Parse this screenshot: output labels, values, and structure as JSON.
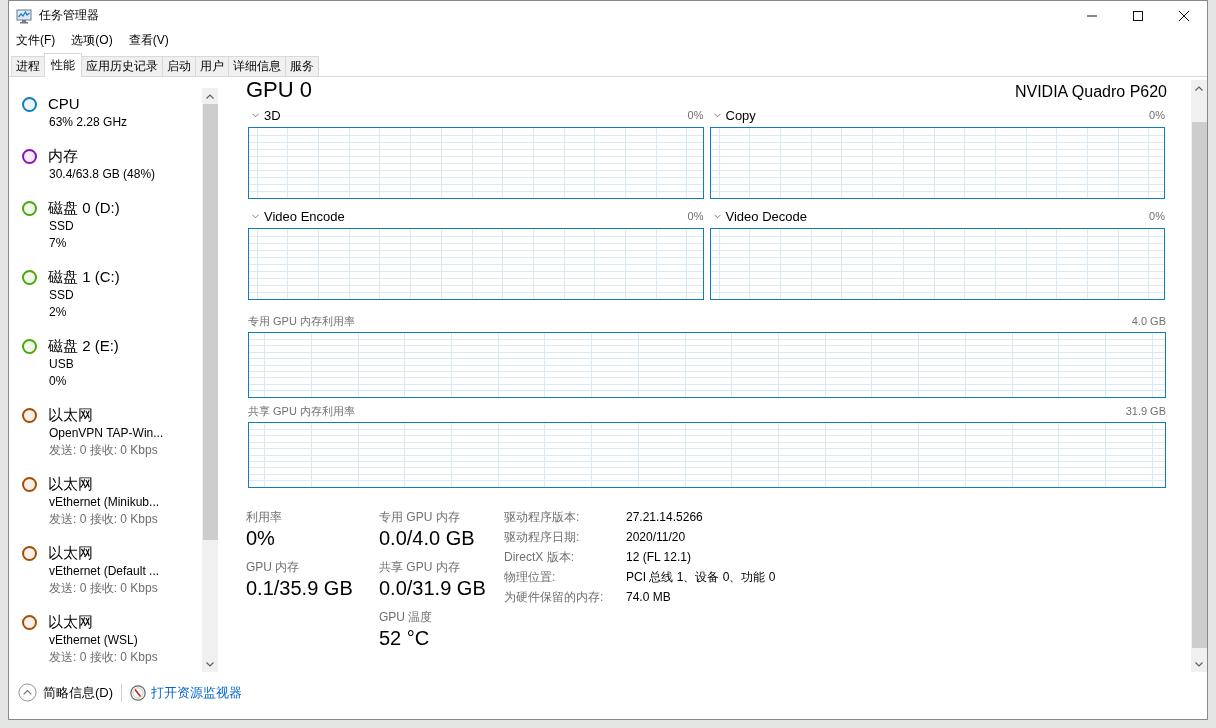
{
  "window": {
    "title": "任务管理器"
  },
  "menu": [
    {
      "label": "文件(F)"
    },
    {
      "label": "选项(O)"
    },
    {
      "label": "查看(V)"
    }
  ],
  "tabs": [
    {
      "label": "进程",
      "selected": false
    },
    {
      "label": "性能",
      "selected": true
    },
    {
      "label": "应用历史记录",
      "selected": false
    },
    {
      "label": "启动",
      "selected": false
    },
    {
      "label": "用户",
      "selected": false
    },
    {
      "label": "详细信息",
      "selected": false
    },
    {
      "label": "服务",
      "selected": false
    }
  ],
  "sidebar": {
    "items": [
      {
        "name": "CPU",
        "color": "#117dbb",
        "details": [
          "63% 2.28 GHz"
        ]
      },
      {
        "name": "内存",
        "color": "#8b12ae",
        "details": [
          "30.4/63.8 GB (48%)"
        ]
      },
      {
        "name": "磁盘 0 (D:)",
        "color": "#4da60c",
        "details": [
          "SSD",
          "7%"
        ]
      },
      {
        "name": "磁盘 1 (C:)",
        "color": "#4da60c",
        "details": [
          "SSD",
          "2%"
        ]
      },
      {
        "name": "磁盘 2 (E:)",
        "color": "#4da60c",
        "details": [
          "USB",
          "0%"
        ]
      },
      {
        "name": "以太网",
        "color": "#a74f01",
        "details": [
          "OpenVPN TAP-Win..."
        ],
        "throughput": "发送: 0 接收: 0 Kbps"
      },
      {
        "name": "以太网",
        "color": "#a74f01",
        "details": [
          "vEthernet (Minikub..."
        ],
        "throughput": "发送: 0 接收: 0 Kbps"
      },
      {
        "name": "以太网",
        "color": "#a74f01",
        "details": [
          "vEthernet (Default ..."
        ],
        "throughput": "发送: 0 接收: 0 Kbps"
      },
      {
        "name": "以太网",
        "color": "#a74f01",
        "details": [
          "vEthernet (WSL)"
        ],
        "throughput": "发送: 0 接收: 0 Kbps"
      }
    ]
  },
  "gpu": {
    "title": "GPU 0",
    "model": "NVIDIA Quadro P620",
    "engines": [
      {
        "name": "3D",
        "reading": "0%"
      },
      {
        "name": "Copy",
        "reading": "0%"
      },
      {
        "name": "Video Encode",
        "reading": "0%"
      },
      {
        "name": "Video Decode",
        "reading": "0%"
      }
    ],
    "memory_graphs": [
      {
        "label": "专用 GPU 内存利用率",
        "max": "4.0 GB"
      },
      {
        "label": "共享 GPU 内存利用率",
        "max": "31.9 GB"
      }
    ],
    "stat_columns": [
      [
        {
          "label": "利用率",
          "value": "0%"
        },
        {
          "label": "GPU 内存",
          "value": "0.1/35.9 GB"
        }
      ],
      [
        {
          "label": "专用 GPU 内存",
          "value": "0.0/4.0 GB"
        },
        {
          "label": "共享 GPU 内存",
          "value": "0.0/31.9 GB"
        },
        {
          "label": "GPU 温度",
          "value": "52 °C"
        }
      ]
    ],
    "properties": [
      {
        "label": "驱动程序版本:",
        "value": "27.21.14.5266"
      },
      {
        "label": "驱动程序日期:",
        "value": "2020/11/20"
      },
      {
        "label": "DirectX 版本:",
        "value": "12 (FL 12.1)"
      },
      {
        "label": "物理位置:",
        "value": "PCI 总线 1、设备 0、功能 0"
      },
      {
        "label": "为硬件保留的内存:",
        "value": "74.0 MB"
      }
    ]
  },
  "footer": {
    "summary": "简略信息(D)",
    "link": "打开资源监视器"
  }
}
